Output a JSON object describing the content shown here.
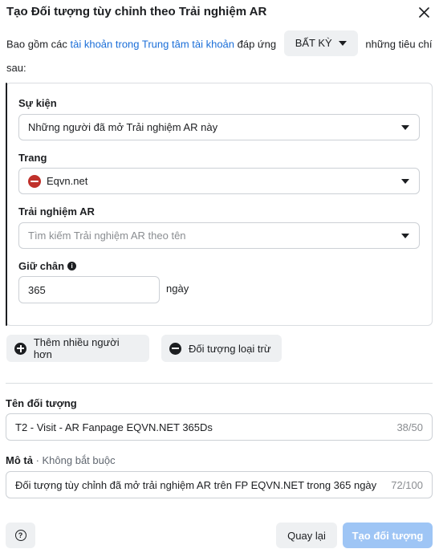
{
  "dialog": {
    "title": "Tạo Đối tượng tùy chỉnh theo Trải nghiệm AR"
  },
  "intro": {
    "prefix": "Bao gồm các ",
    "link": "tài khoản trong Trung tâm tài khoản",
    "middle": " đáp ứng",
    "match_value": "BẤT KỲ",
    "suffix": "những tiêu chí sau:"
  },
  "criteria": {
    "event": {
      "label": "Sự kiện",
      "value": "Những người đã mở Trải nghiệm AR này"
    },
    "page": {
      "label": "Trang",
      "value": "Eqvn.net"
    },
    "ar_experience": {
      "label": "Trải nghiệm AR",
      "placeholder": "Tìm kiếm Trải nghiệm AR theo tên"
    },
    "retention": {
      "label": "Giữ chân",
      "value": "365",
      "unit": "ngày"
    }
  },
  "actions": {
    "include_more": "Thêm nhiều người hơn",
    "exclude": "Đối tượng loại trừ"
  },
  "audience_name": {
    "label": "Tên đối tượng",
    "value": "T2 - Visit - AR Fanpage EQVN.NET 365Ds",
    "count": "38/50"
  },
  "description": {
    "label": "Mô tả",
    "optional": " · Không bắt buộc",
    "value": "Đối tượng tùy chỉnh đã mở trải nghiệm AR trên FP EQVN.NET trong 365 ngày",
    "count": "72/100"
  },
  "footer": {
    "back_label": "Quay lại",
    "create_label": "Tạo đối tượng"
  },
  "colors": {
    "link": "#1a6ed8",
    "primary_disabled": "#9ec5f5",
    "secondary_bg": "#eef0f2",
    "page_logo": "#c0312b"
  }
}
